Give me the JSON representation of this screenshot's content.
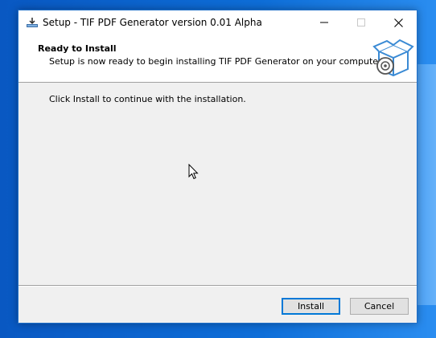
{
  "window": {
    "title": "Setup - TIF PDF Generator version 0.01 Alpha"
  },
  "header": {
    "title": "Ready to Install",
    "subtitle": "Setup is now ready to begin installing TIF PDF Generator on your computer."
  },
  "body": {
    "message": "Click Install to continue with the installation."
  },
  "buttons": {
    "install_label": "Install",
    "cancel_label": "Cancel"
  },
  "icons": {
    "app": "installer-icon",
    "header": "software-box-icon",
    "minimize": "minimize-icon",
    "maximize": "maximize-icon",
    "close": "close-icon",
    "cursor": "mouse-cursor-icon"
  },
  "colors": {
    "desktop": "#0a63c9",
    "window_border": "#1f6fc8",
    "focus": "#0078d7",
    "panel": "#f0f0f0"
  }
}
